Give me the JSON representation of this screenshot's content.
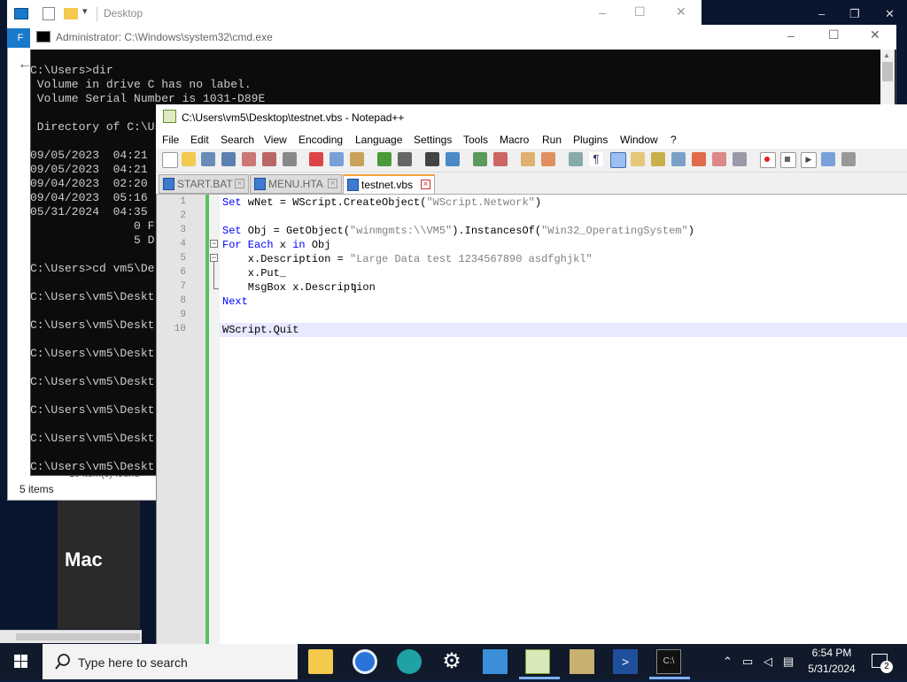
{
  "explorer": {
    "title": "Desktop",
    "ribbon_label": "F",
    "status": "5 items",
    "status_behind": "19 item(s) found"
  },
  "mac_tile": {
    "label": "Mac"
  },
  "cmd": {
    "title": "Administrator: C:\\Windows\\system32\\cmd.exe",
    "lines": [
      "C:\\Users>dir",
      " Volume in drive C has no label.",
      " Volume Serial Number is 1031-D89E",
      "",
      " Directory of C:\\Users",
      "",
      "09/05/2023  04:21",
      "09/05/2023  04:21",
      "09/04/2023  02:20",
      "09/04/2023  05:16",
      "05/31/2024  04:35",
      "               0 F",
      "               5 D",
      "",
      "C:\\Users>cd vm5\\De",
      "",
      "C:\\Users\\vm5\\Deskt",
      "",
      "C:\\Users\\vm5\\Deskt",
      "",
      "C:\\Users\\vm5\\Deskt",
      "",
      "C:\\Users\\vm5\\Deskt",
      "",
      "C:\\Users\\vm5\\Deskt",
      "",
      "C:\\Users\\vm5\\Deskt",
      "",
      "C:\\Users\\vm5\\Deskt"
    ]
  },
  "npp": {
    "title": "C:\\Users\\vm5\\Desktop\\testnet.vbs - Notepad++",
    "menu": [
      "File",
      "Edit",
      "Search",
      "View",
      "Encoding",
      "Language",
      "Settings",
      "Tools",
      "Macro",
      "Run",
      "Plugins",
      "Window",
      "?"
    ],
    "tabs": [
      {
        "label": "START.BAT",
        "active": false
      },
      {
        "label": "MENU.HTA",
        "active": false
      },
      {
        "label": "testnet.vbs",
        "active": true
      }
    ],
    "line_numbers": [
      "1",
      "2",
      "3",
      "4",
      "5",
      "6",
      "7",
      "8",
      "9",
      "10"
    ],
    "code": {
      "l1_kw": "Set",
      "l1_a": " wNet = WScript.CreateObject(",
      "l1_str": "\"WScript.Network\"",
      "l1_b": ")",
      "l3_kw": "Set",
      "l3_a": " Obj = GetObject(",
      "l3_str1": "\"winmgmts:\\\\VM5\"",
      "l3_b": ").InstancesOf(",
      "l3_str2": "\"Win32_OperatingSystem\"",
      "l3_c": ")",
      "l4_kw1": "For Each",
      "l4_a": " x ",
      "l4_kw2": "in",
      "l4_b": " Obj",
      "l5_a": "    x.Description = ",
      "l5_str": "\"Large Data test 1234567890 asdfghjkl\"",
      "l6": "    x.Put_",
      "l7": "    MsgBox x.Description",
      "l8_kw": "Next",
      "l10": "WScript.Quit"
    }
  },
  "taskbar": {
    "search_placeholder": "Type here to search",
    "time": "6:54 PM",
    "date": "5/31/2024",
    "notification_count": "2",
    "apps": [
      "file-explorer-icon",
      "chrome-icon",
      "edge-icon",
      "settings-icon",
      "remote-desktop-icon",
      "notepad-plus-plus-icon",
      "network-tool-icon",
      "powershell-icon",
      "cmd-icon"
    ]
  },
  "colors": {
    "accent": "#1979ca",
    "taskbar": "#101a2b",
    "keyword": "#0000ff",
    "string": "#808080",
    "active_tab_border": "#f7a23a",
    "change_bar": "#54c25e"
  }
}
